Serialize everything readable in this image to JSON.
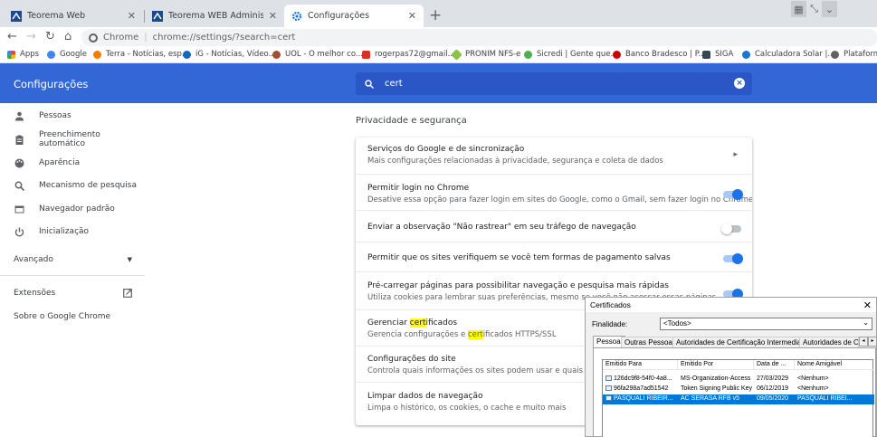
{
  "tabs": [
    {
      "label": "Teorema Web",
      "close": "✕"
    },
    {
      "label": "Teorema WEB Administrador",
      "close": "✕"
    },
    {
      "label": "Configurações",
      "close": "✕"
    }
  ],
  "new_tab_icon": "plus-icon",
  "address": {
    "site_label": "Chrome",
    "url": "chrome://settings/?search=cert"
  },
  "bookmarks": [
    {
      "label": "Apps",
      "color": "#ea4335"
    },
    {
      "label": "Google",
      "color": "#4285f4"
    },
    {
      "label": "Terra - Notícias, esp...",
      "color": "#f57c00"
    },
    {
      "label": "iG - Notícias, Vídeo...",
      "color": "#1565c0"
    },
    {
      "label": "UOL - O melhor co...",
      "color": "#a0522d"
    },
    {
      "label": "rogerpas72@gmail....",
      "color": "#d93025"
    },
    {
      "label": "PRONIM NFS-e",
      "color": "#8bc34a"
    },
    {
      "label": "Sicredi | Gente que...",
      "color": "#4caf50"
    },
    {
      "label": "Banco Bradesco | P...",
      "color": "#cc0000"
    },
    {
      "label": "SIGA",
      "color": "#37474f"
    },
    {
      "label": "Calculadora Solar |...",
      "color": "#1976d2"
    },
    {
      "label": "Plataforma",
      "color": "#616161"
    }
  ],
  "header": {
    "title": "Configurações",
    "search_value": "cert",
    "accent": "#3367d6"
  },
  "sidebar": {
    "items": [
      {
        "label": "Pessoas",
        "icon": "person-icon"
      },
      {
        "label": "Preenchimento automático",
        "icon": "clipboard-icon"
      },
      {
        "label": "Aparência",
        "icon": "palette-icon"
      },
      {
        "label": "Mecanismo de pesquisa",
        "icon": "search-icon"
      },
      {
        "label": "Navegador padrão",
        "icon": "browser-icon"
      },
      {
        "label": "Inicialização",
        "icon": "power-icon"
      }
    ],
    "advanced": "Avançado",
    "extensions": "Extensões",
    "about": "Sobre o Google Chrome"
  },
  "main": {
    "section_title": "Privacidade e segurança",
    "rows": [
      {
        "title": "Serviços do Google e de sincronização",
        "subtitle": "Mais configurações relacionadas à privacidade, segurança e coleta de dados"
      },
      {
        "title": "Permitir login no Chrome",
        "subtitle": "Desative essa opção para fazer login em sites do Google, como o Gmail, sem fazer login no Chrome",
        "toggle": true
      },
      {
        "title": "Enviar a observação \"Não rastrear\" em seu tráfego de navegação",
        "toggle": false
      },
      {
        "title": "Permitir que os sites verifiquem se você tem formas de pagamento salvas",
        "toggle": true
      },
      {
        "title": "Pré-carregar páginas para possibilitar navegação e pesquisa mais rápidas",
        "subtitle": "Utiliza cookies para lembrar suas preferências, mesmo se você não acessar essas páginas",
        "toggle": true
      },
      {
        "title_pre": "Gerenciar ",
        "title_hl": "cert",
        "title_post": "ificados",
        "sub_pre": "Gerencia configurações e ",
        "sub_hl": "cert",
        "sub_post": "ificados HTTPS/SSL"
      },
      {
        "title": "Configurações do site",
        "subtitle": "Controla quais informações os sites podem usar e quais conteúdos"
      },
      {
        "title": "Limpar dados de navegação",
        "subtitle": "Limpa o histórico, os cookies, o cache e muito mais"
      }
    ]
  },
  "cert_dialog": {
    "title": "Certificados",
    "purpose_label": "Finalidade:",
    "purpose_value": "<Todos>",
    "tabs": [
      "Pessoal",
      "Outras Pessoas",
      "Autoridades de Certificação Intermediárias",
      "Autoridades de Ce"
    ],
    "columns": [
      "Emitido Para",
      "Emitido Por",
      "Data de ...",
      "Nome Amigável"
    ],
    "rows": [
      [
        "126dc9f8-54f0-4a8...",
        "MS-Organization-Access",
        "27/03/2029",
        "<Nenhum>"
      ],
      [
        "96fa298a7ad51542",
        "Token Signing Public Key",
        "06/12/2019",
        "<Nenhum>"
      ],
      [
        "PASQUALI RIBEIR...",
        "AC SERASA RFB v5",
        "09/05/2020",
        "PASQUALI RIBEI..."
      ]
    ],
    "selected_row": 2
  }
}
